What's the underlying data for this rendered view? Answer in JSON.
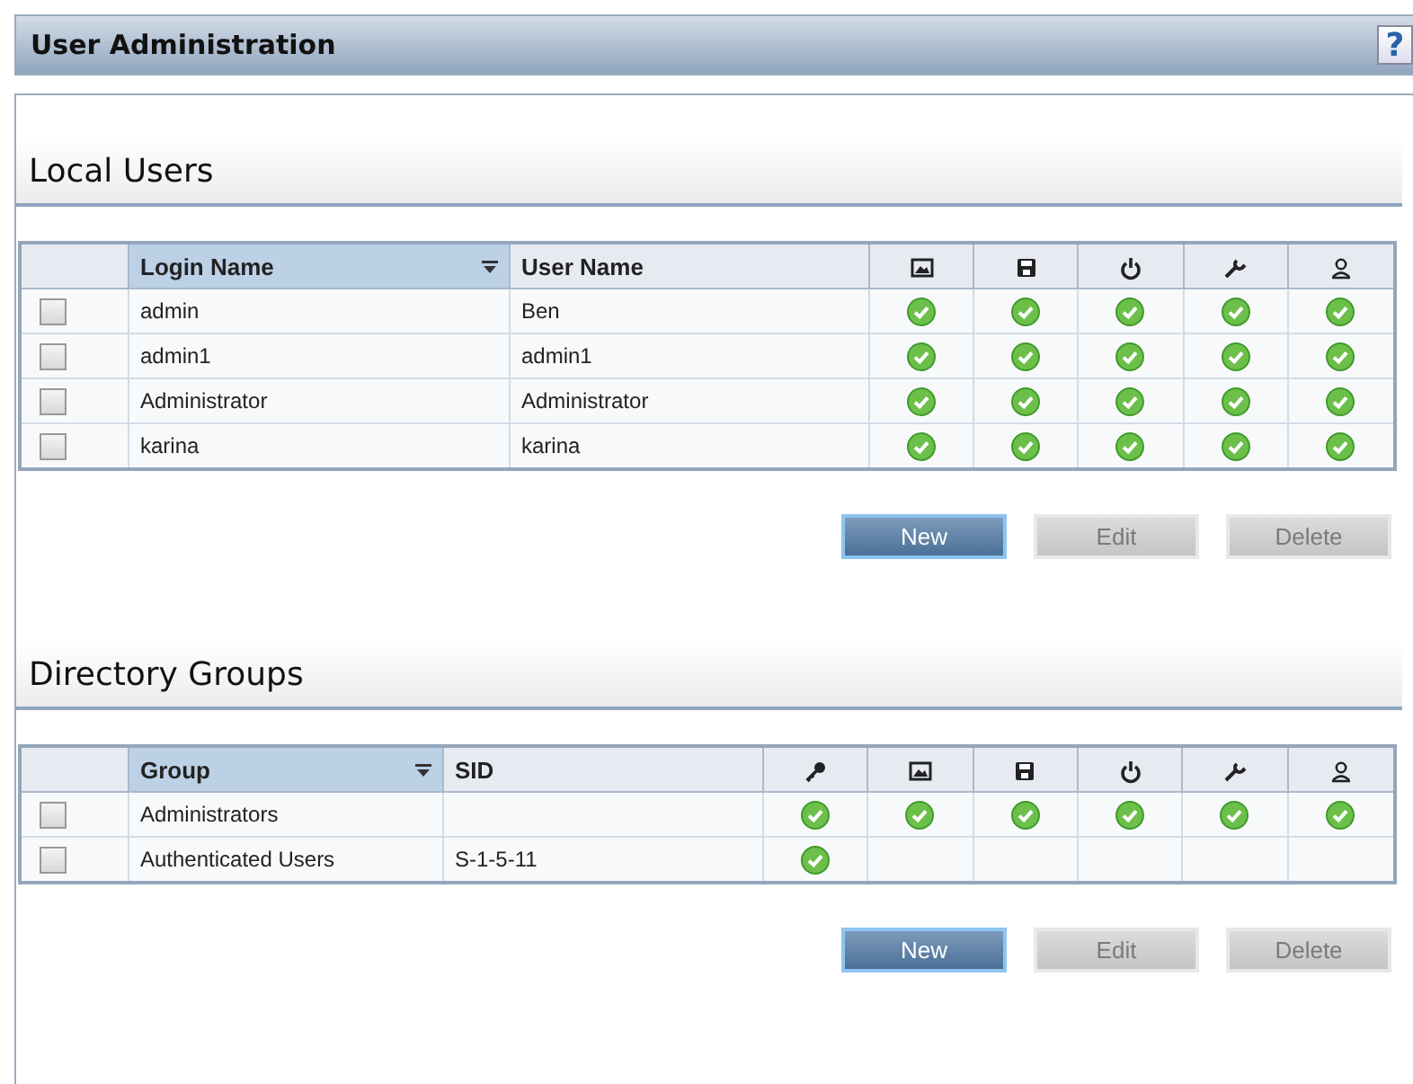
{
  "window": {
    "title": "User Administration",
    "help": "?"
  },
  "sections": [
    {
      "title": "Local Users",
      "columns": [
        {
          "label": "Login Name",
          "sorted": true
        },
        {
          "label": "User Name",
          "sorted": false
        }
      ],
      "icon_columns": [
        {
          "kind": "picture"
        },
        {
          "kind": "save"
        },
        {
          "kind": "power"
        },
        {
          "kind": "wrench"
        },
        {
          "kind": "user"
        }
      ],
      "rows": [
        {
          "checked": false,
          "cells": [
            "admin",
            "Ben"
          ],
          "permissions": [
            true,
            true,
            true,
            true,
            true
          ]
        },
        {
          "checked": false,
          "cells": [
            "admin1",
            "admin1"
          ],
          "permissions": [
            true,
            true,
            true,
            true,
            true
          ]
        },
        {
          "checked": false,
          "cells": [
            "Administrator",
            "Administrator"
          ],
          "permissions": [
            true,
            true,
            true,
            true,
            true
          ]
        },
        {
          "checked": false,
          "cells": [
            "karina",
            "karina"
          ],
          "permissions": [
            true,
            true,
            true,
            true,
            true
          ]
        }
      ],
      "buttons": [
        {
          "label": "New",
          "disabled": false
        },
        {
          "label": "Edit",
          "disabled": true
        },
        {
          "label": "Delete",
          "disabled": true
        }
      ]
    },
    {
      "title": "Directory Groups",
      "columns": [
        {
          "label": "Group",
          "sorted": true
        },
        {
          "label": "SID",
          "sorted": false
        }
      ],
      "icon_columns": [
        {
          "kind": "key"
        },
        {
          "kind": "picture"
        },
        {
          "kind": "save"
        },
        {
          "kind": "power"
        },
        {
          "kind": "wrench"
        },
        {
          "kind": "user"
        }
      ],
      "rows": [
        {
          "checked": false,
          "cells": [
            "Administrators",
            ""
          ],
          "permissions": [
            true,
            true,
            true,
            true,
            true,
            true
          ]
        },
        {
          "checked": false,
          "cells": [
            "Authenticated Users",
            "S-1-5-11"
          ],
          "permissions": [
            true,
            false,
            false,
            false,
            false,
            false
          ]
        }
      ],
      "buttons": [
        {
          "label": "New",
          "disabled": false
        },
        {
          "label": "Edit",
          "disabled": true
        },
        {
          "label": "Delete",
          "disabled": true
        }
      ]
    }
  ]
}
